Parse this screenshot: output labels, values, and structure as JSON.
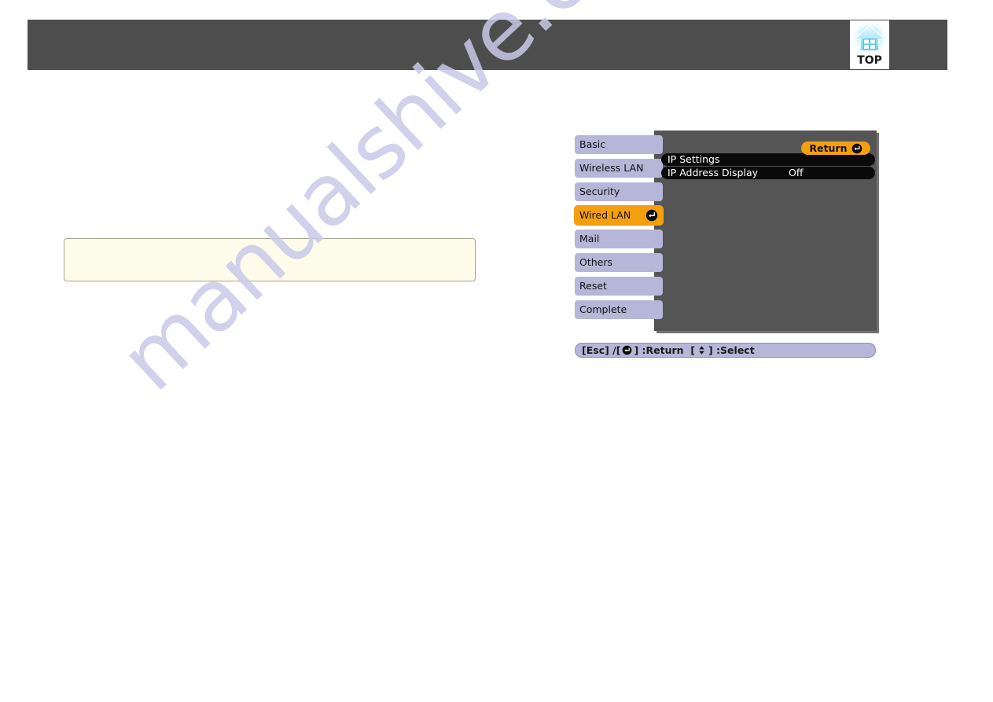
{
  "page": {
    "watermark_text": "manualshive.com",
    "background_color": "#ffffff"
  },
  "header": {
    "bar_color": "#4d4d4d",
    "top_button": {
      "label": "TOP",
      "icon": "home-icon",
      "icon_color": "#29b6e8"
    }
  },
  "note_box": {
    "text": "",
    "background_color": "#fdfbe9",
    "border_color": "#a6a392"
  },
  "osd": {
    "panel_color": "#555555",
    "accent_color": "#f49f10",
    "tab_color": "#b6b6d8",
    "tabs": [
      {
        "label": "Basic",
        "selected": false,
        "has_enter_icon": false
      },
      {
        "label": "Wireless LAN",
        "selected": false,
        "has_enter_icon": false
      },
      {
        "label": "Security",
        "selected": false,
        "has_enter_icon": false
      },
      {
        "label": "Wired LAN",
        "selected": true,
        "has_enter_icon": true
      },
      {
        "label": "Mail",
        "selected": false,
        "has_enter_icon": false
      },
      {
        "label": "Others",
        "selected": false,
        "has_enter_icon": false
      },
      {
        "label": "Reset",
        "selected": false,
        "has_enter_icon": false
      },
      {
        "label": "Complete",
        "selected": false,
        "has_enter_icon": false
      }
    ],
    "return_button": {
      "label": "Return",
      "icon": "enter-key-icon"
    },
    "rows": [
      {
        "label": "IP Settings",
        "value": ""
      },
      {
        "label": "IP Address Display",
        "value": "Off"
      }
    ],
    "status_bar": {
      "esc_text": "[Esc] /[",
      "enter_icon": "enter-key-icon",
      "return_text": "] :Return  [",
      "select_icon": "up-down-arrow-icon",
      "select_text": "] :Select"
    }
  }
}
